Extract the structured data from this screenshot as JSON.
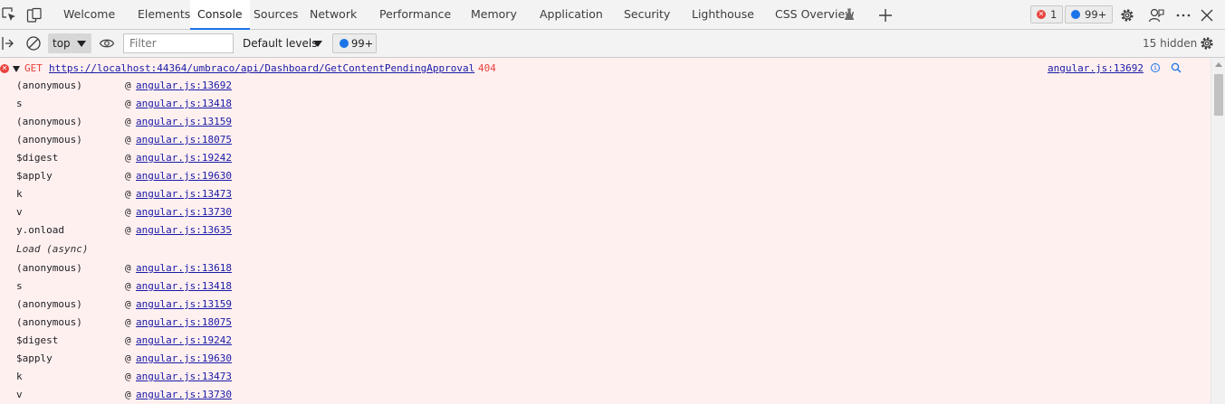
{
  "tabs": [
    {
      "label": "Welcome",
      "active": false
    },
    {
      "label": "Elements",
      "active": false
    },
    {
      "label": "Console",
      "active": true
    },
    {
      "label": "Sources",
      "active": false
    },
    {
      "label": "Network",
      "active": false
    },
    {
      "label": "Performance",
      "active": false
    },
    {
      "label": "Memory",
      "active": false
    },
    {
      "label": "Application",
      "active": false
    },
    {
      "label": "Security",
      "active": false
    },
    {
      "label": "Lighthouse",
      "active": false
    },
    {
      "label": "CSS Overview",
      "active": false
    }
  ],
  "badges": {
    "errors": "1",
    "messages": "99+"
  },
  "toolbar": {
    "context": "top",
    "filter_placeholder": "Filter",
    "levels": "Default levels",
    "messages": "99+",
    "hidden": "15 hidden"
  },
  "error": {
    "method": "GET",
    "url": "https://localhost:44364/umbraco/api/Dashboard/GetContentPendingApproval",
    "status": "404",
    "source": "angular.js:13692"
  },
  "stack": [
    {
      "fn": "(anonymous)",
      "at": "@",
      "loc": "angular.js:13692"
    },
    {
      "fn": "s",
      "at": "@",
      "loc": "angular.js:13418"
    },
    {
      "fn": "(anonymous)",
      "at": "@",
      "loc": "angular.js:13159"
    },
    {
      "fn": "(anonymous)",
      "at": "@",
      "loc": "angular.js:18075"
    },
    {
      "fn": "$digest",
      "at": "@",
      "loc": "angular.js:19242"
    },
    {
      "fn": "$apply",
      "at": "@",
      "loc": "angular.js:19630"
    },
    {
      "fn": "k",
      "at": "@",
      "loc": "angular.js:13473"
    },
    {
      "fn": "v",
      "at": "@",
      "loc": "angular.js:13730"
    },
    {
      "fn": "y.onload",
      "at": "@",
      "loc": "angular.js:13635"
    }
  ],
  "async_label": "Load (async)",
  "stack2": [
    {
      "fn": "(anonymous)",
      "at": "@",
      "loc": "angular.js:13618"
    },
    {
      "fn": "s",
      "at": "@",
      "loc": "angular.js:13418"
    },
    {
      "fn": "(anonymous)",
      "at": "@",
      "loc": "angular.js:13159"
    },
    {
      "fn": "(anonymous)",
      "at": "@",
      "loc": "angular.js:18075"
    },
    {
      "fn": "$digest",
      "at": "@",
      "loc": "angular.js:19242"
    },
    {
      "fn": "$apply",
      "at": "@",
      "loc": "angular.js:19630"
    },
    {
      "fn": "k",
      "at": "@",
      "loc": "angular.js:13473"
    },
    {
      "fn": "v",
      "at": "@",
      "loc": "angular.js:13730"
    }
  ],
  "colors": {
    "accent": "#1a73e8",
    "error": "#e8423c",
    "link": "#1a1aa6",
    "error_bg": "#fff0f0"
  }
}
